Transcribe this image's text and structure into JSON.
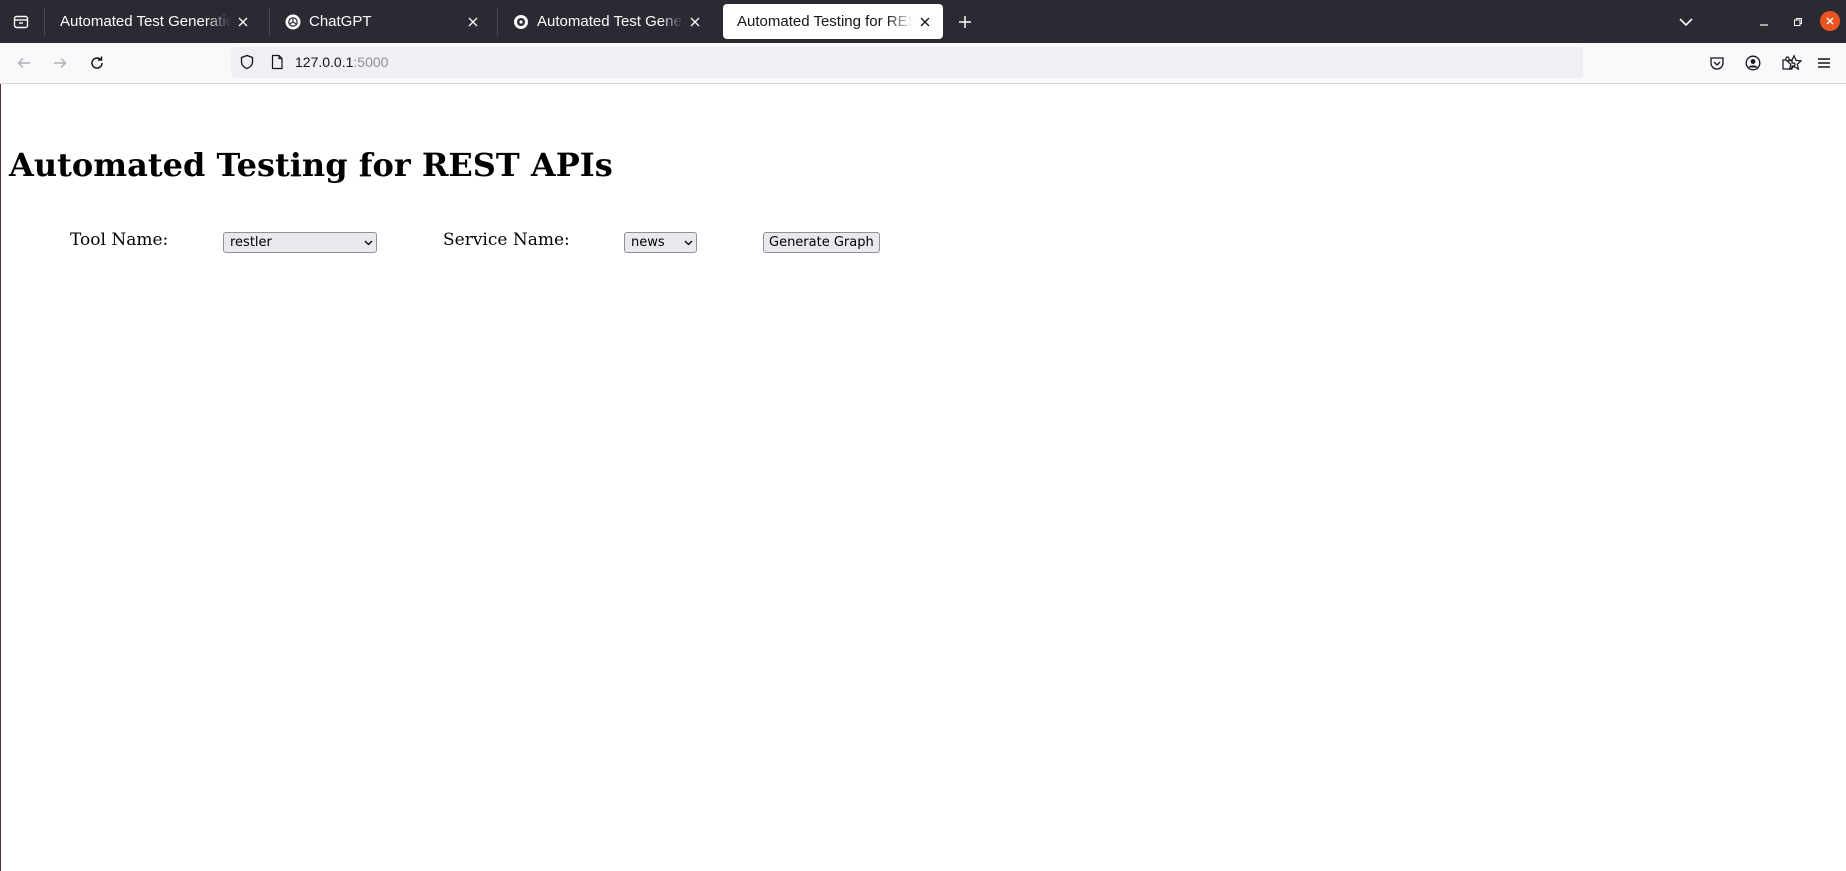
{
  "browser": {
    "tabs": [
      {
        "title": "Automated Test Generation",
        "favicon": "none",
        "active": false
      },
      {
        "title": "ChatGPT",
        "favicon": "chatgpt-logo",
        "active": false
      },
      {
        "title": "Automated Test Generation",
        "favicon": "site-logo",
        "active": false
      },
      {
        "title": "Automated Testing for REST APIs",
        "favicon": "none",
        "active": true
      }
    ],
    "url": {
      "host": "127.0.0.1",
      "port": ":5000"
    }
  },
  "page": {
    "title": "Automated Testing for REST APIs",
    "form": {
      "tool_label": "Tool Name:",
      "tool_value": "restler",
      "service_label": "Service Name:",
      "service_value": "news",
      "generate_button": "Generate Graph"
    }
  },
  "colors": {
    "tabstrip_bg": "#2b2a33",
    "close_button": "#e95420"
  }
}
